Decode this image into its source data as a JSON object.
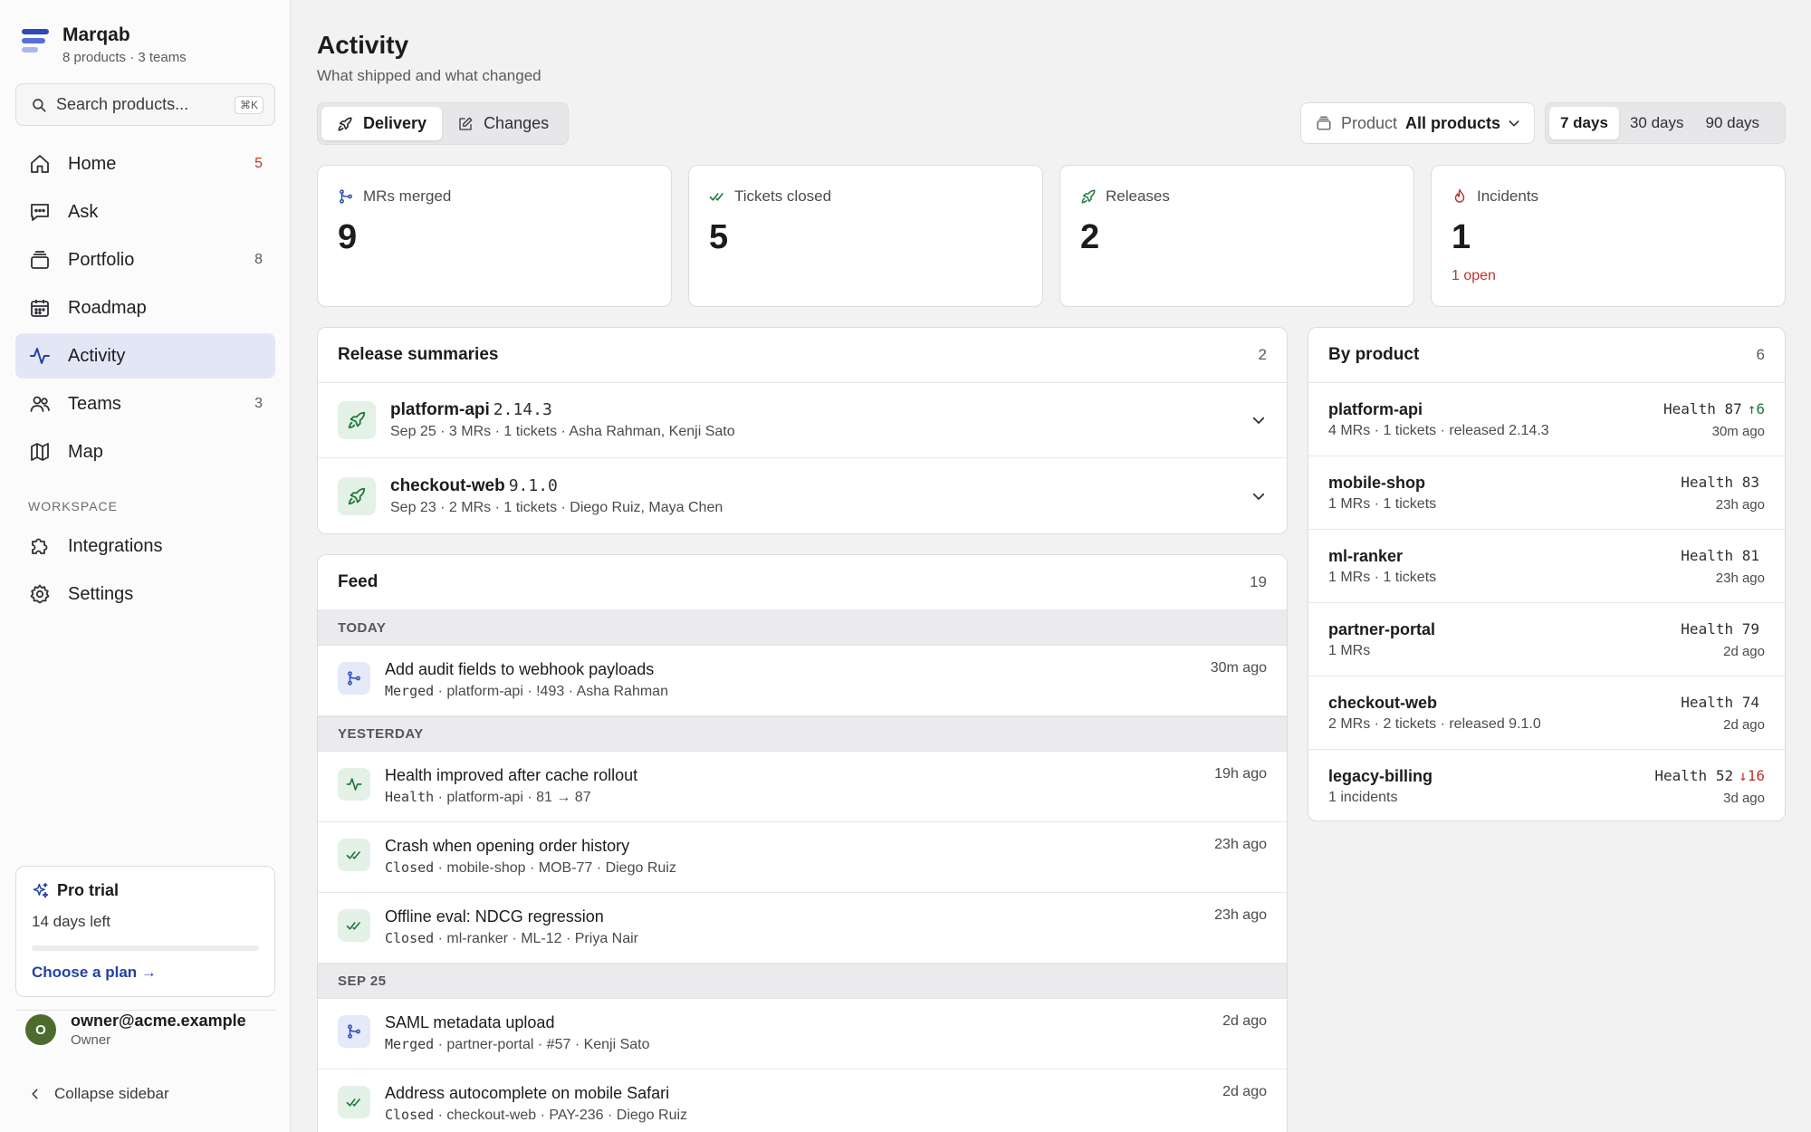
{
  "brand": {
    "name": "Marqab",
    "sub": "8 products · 3 teams"
  },
  "search": {
    "placeholder": "Search products...",
    "shortcut": "⌘K"
  },
  "nav": [
    {
      "label": "Home",
      "count": "5",
      "icon": "home-icon"
    },
    {
      "label": "Ask",
      "count": "",
      "icon": "chat-icon"
    },
    {
      "label": "Portfolio",
      "count": "8",
      "icon": "stack-icon"
    },
    {
      "label": "Roadmap",
      "count": "",
      "icon": "calendar-icon"
    },
    {
      "label": "Activity",
      "count": "",
      "icon": "pulse-icon"
    },
    {
      "label": "Teams",
      "count": "3",
      "icon": "users-icon"
    },
    {
      "label": "Map",
      "count": "",
      "icon": "map-icon"
    }
  ],
  "workspace": {
    "label": "WORKSPACE",
    "items": [
      {
        "label": "Integrations",
        "icon": "puzzle-icon"
      },
      {
        "label": "Settings",
        "icon": "gear-icon"
      }
    ]
  },
  "trial": {
    "title": "Pro trial",
    "days": "14 days left",
    "progress": 0.0,
    "link": "Choose a plan →"
  },
  "user": {
    "initial": "O",
    "email": "owner@acme.example",
    "role": "Owner"
  },
  "collapse": "Collapse sidebar",
  "page": {
    "title": "Activity",
    "subtitle": "What shipped and what changed"
  },
  "tabs": [
    {
      "label": "Delivery",
      "icon": "rocket-icon",
      "active": true
    },
    {
      "label": "Changes",
      "icon": "edit-icon",
      "active": false
    }
  ],
  "product_filter": {
    "key": "Product",
    "value": "All products"
  },
  "ranges": [
    {
      "label": "7 days",
      "active": true
    },
    {
      "label": "30 days",
      "active": false
    },
    {
      "label": "90 days",
      "active": false
    }
  ],
  "stats": [
    {
      "label": "MRs merged",
      "value": "9",
      "note": "",
      "icon": "merge-icon"
    },
    {
      "label": "Tickets closed",
      "value": "5",
      "note": "",
      "icon": "check-icon"
    },
    {
      "label": "Releases",
      "value": "2",
      "note": "",
      "icon": "rocket-icon"
    },
    {
      "label": "Incidents",
      "value": "1",
      "note": "1 open",
      "icon": "flame-icon"
    }
  ],
  "releases": {
    "title": "Release summaries",
    "count": "2",
    "items": [
      {
        "name": "platform-api",
        "version": "2.14.3",
        "meta": "Sep 25 · 3 MRs · 1 tickets · Asha Rahman, Kenji Sato"
      },
      {
        "name": "checkout-web",
        "version": "9.1.0",
        "meta": "Sep 23 · 2 MRs · 1 tickets · Diego Ruiz, Maya Chen"
      }
    ]
  },
  "feed": {
    "title": "Feed",
    "count": "19",
    "groups": [
      {
        "label": "TODAY",
        "items": [
          {
            "title": "Add audit fields to webhook payloads",
            "kind": "Merged",
            "meta": " · platform-api · !493 · Asha Rahman",
            "time": "30m ago",
            "icon": "merge-icon"
          }
        ]
      },
      {
        "label": "YESTERDAY",
        "items": [
          {
            "title": "Health improved after cache rollout",
            "kind": "Health",
            "meta": " · platform-api · 81 → 87",
            "time": "19h ago",
            "icon": "pulse-icon"
          },
          {
            "title": "Crash when opening order history",
            "kind": "Closed",
            "meta": " · mobile-shop · MOB-77 · Diego Ruiz",
            "time": "23h ago",
            "icon": "check-icon"
          },
          {
            "title": "Offline eval: NDCG regression",
            "kind": "Closed",
            "meta": " · ml-ranker · ML-12 · Priya Nair",
            "time": "23h ago",
            "icon": "check-icon"
          }
        ]
      },
      {
        "label": "SEP 25",
        "items": [
          {
            "title": "SAML metadata upload",
            "kind": "Merged",
            "meta": " · partner-portal · #57 · Kenji Sato",
            "time": "2d ago",
            "icon": "merge-icon"
          },
          {
            "title": "Address autocomplete on mobile Safari",
            "kind": "Closed",
            "meta": " · checkout-web · PAY-236 · Diego Ruiz",
            "time": "2d ago",
            "icon": "check-icon"
          }
        ]
      }
    ]
  },
  "by_product": {
    "title": "By product",
    "count": "6",
    "items": [
      {
        "name": "platform-api",
        "meta": "4 MRs · 1 tickets · released 2.14.3",
        "health": "Health 87",
        "delta": "↑6",
        "delta_color": "#1f7a3a",
        "time": "30m ago"
      },
      {
        "name": "mobile-shop",
        "meta": "1 MRs · 1 tickets",
        "health": "Health 83",
        "delta": "",
        "delta_color": "",
        "time": "23h ago"
      },
      {
        "name": "ml-ranker",
        "meta": "1 MRs · 1 tickets",
        "health": "Health 81",
        "delta": "",
        "delta_color": "",
        "time": "23h ago"
      },
      {
        "name": "partner-portal",
        "meta": "1 MRs",
        "health": "Health 79",
        "delta": "",
        "delta_color": "",
        "time": "2d ago"
      },
      {
        "name": "checkout-web",
        "meta": "2 MRs · 2 tickets · released 9.1.0",
        "health": "Health 74",
        "delta": "",
        "delta_color": "",
        "time": "2d ago"
      },
      {
        "name": "legacy-billing",
        "meta": "1 incidents",
        "health": "Health 52",
        "delta": "↓16",
        "delta_color": "#c0352b",
        "time": "3d ago"
      }
    ]
  },
  "colors": {
    "accent": "#2340a8",
    "active_nav": "#e3e6f4",
    "danger": "#c0352b",
    "success": "#1f7a3a"
  }
}
